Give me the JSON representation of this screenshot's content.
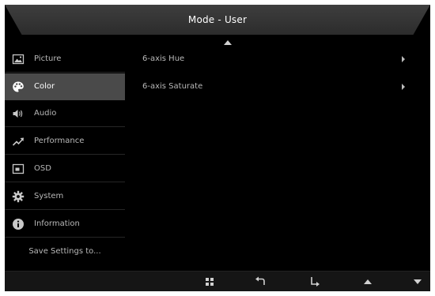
{
  "header": {
    "title": "Mode - User"
  },
  "sidebar": {
    "items": [
      {
        "label": "Picture",
        "icon": "picture-icon"
      },
      {
        "label": "Color",
        "icon": "palette-icon",
        "active": true
      },
      {
        "label": "Audio",
        "icon": "speaker-icon"
      },
      {
        "label": "Performance",
        "icon": "trend-up-icon"
      },
      {
        "label": "OSD",
        "icon": "osd-window-icon"
      },
      {
        "label": "System",
        "icon": "gear-icon"
      },
      {
        "label": "Information",
        "icon": "info-icon"
      }
    ],
    "save_label": "Save Settings to..."
  },
  "content": {
    "items": [
      {
        "label": "6-axis Hue"
      },
      {
        "label": "6-axis Saturate"
      }
    ]
  },
  "bottom_bar": {
    "buttons": [
      {
        "icon": "menu-grid-icon"
      },
      {
        "icon": "back-arrow-icon"
      },
      {
        "icon": "enter-arrow-icon"
      },
      {
        "icon": "up-triangle-icon"
      },
      {
        "icon": "down-triangle-icon"
      }
    ]
  },
  "colors": {
    "background": "#000000",
    "active_row": "#4a4a4a",
    "text": "#b8b8b8",
    "active_text": "#ffffff"
  }
}
